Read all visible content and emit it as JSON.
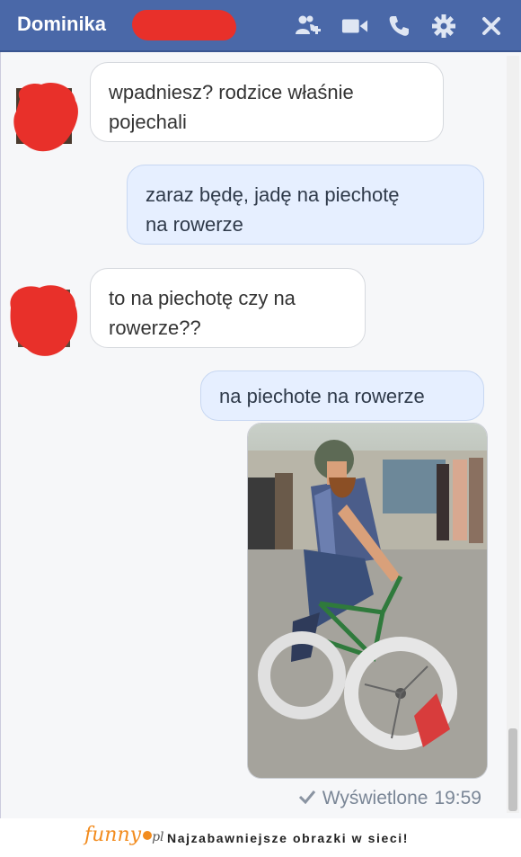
{
  "header": {
    "contact_name": "Dominika",
    "icons": [
      "add-people-icon",
      "video-call-icon",
      "phone-icon",
      "gear-icon",
      "close-icon"
    ],
    "accent_color": "#4a68a8"
  },
  "messages": [
    {
      "direction": "incoming",
      "text_line1": "wpadniesz? rodzice właśnie",
      "text_line2": "pojechali"
    },
    {
      "direction": "outgoing",
      "text_line1": "zaraz będę, jadę na piechotę",
      "text_line2": "na rowerze"
    },
    {
      "direction": "incoming",
      "text_line1": "to na piechotę czy na",
      "text_line2": "rowerze??"
    },
    {
      "direction": "outgoing",
      "text_line1": "na piechote na rowerze"
    }
  ],
  "seen_status": {
    "label": "Wyświetlone",
    "time": "19:59"
  },
  "watermark": {
    "logo": "funny",
    "logo_suffix": "pl",
    "tagline": "Najzabawniejsze obrazki w sieci!"
  }
}
